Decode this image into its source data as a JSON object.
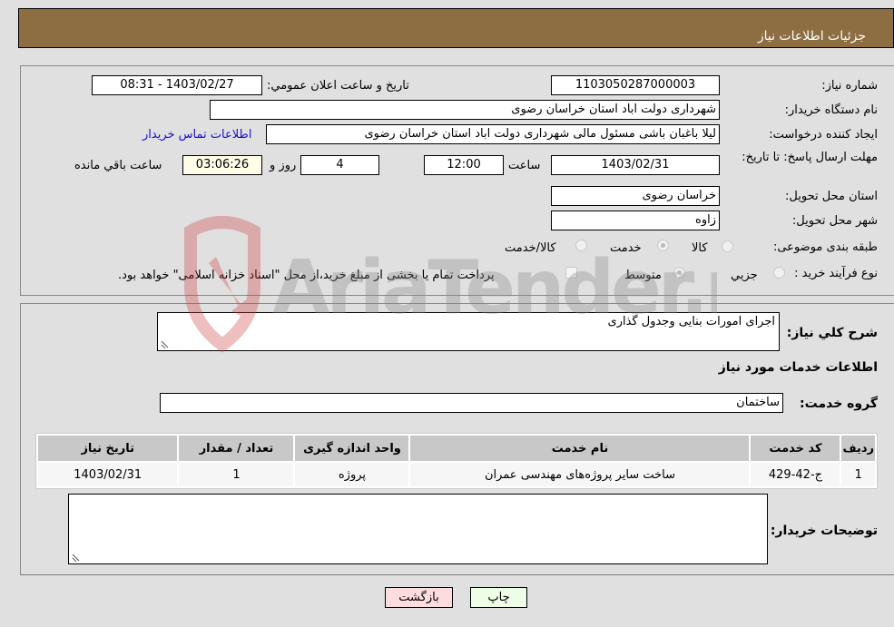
{
  "header": {
    "title": "جزئیات اطلاعات نیاز"
  },
  "fields": {
    "need_number_label": "شماره نیاز:",
    "need_number": "1103050287000003",
    "announce_label": "تاریخ و ساعت اعلان عمومي:",
    "announce_value": "1403/02/27 - 08:31",
    "buyer_org_label": "نام دستگاه خریدار:",
    "buyer_org": "شهرداری دولت اباد استان خراسان رضوی",
    "creator_label": "ایجاد کننده درخواست:",
    "creator": "لیلا باغبان باشی مسئول مالی شهرداری دولت اباد استان خراسان رضوی",
    "contact_link": "اطلاعات تماس خریدار",
    "deadline_label": "مهلت ارسال پاسخ: تا تاریخ:",
    "deadline_date": "1403/02/31",
    "time_label": "ساعت",
    "deadline_time": "12:00",
    "days": "4",
    "days_label": "روز و",
    "remaining": "03:06:26",
    "remaining_label": "ساعت باقي مانده",
    "province_label": "استان محل تحویل:",
    "province": "خراسان رضوی",
    "city_label": "شهر محل تحویل:",
    "city": "زاوه",
    "category_label": "طبقه بندی موضوعی:",
    "category_options": [
      {
        "label": "کالا",
        "checked": false
      },
      {
        "label": "خدمت",
        "checked": true
      },
      {
        "label": "کالا/خدمت",
        "checked": false
      }
    ],
    "process_label": "نوع فرآیند خرید :",
    "process_options": [
      {
        "label": "جزيي",
        "checked": false
      },
      {
        "label": "متوسط",
        "checked": true
      }
    ],
    "treasury_note": "پرداخت تمام یا بخشی از مبلغ خرید،از محل \"اسناد خزانه اسلامی\" خواهد بود.",
    "treasury_checked": false
  },
  "details": {
    "description_label": "شرح کلي نیاز:",
    "description": "اجرای امورات بنایی وجدول گذاری",
    "services_title": "اطلاعات خدمات مورد نیاز",
    "service_group_label": "گروه خدمت:",
    "service_group": "ساختمان",
    "table": {
      "headers": [
        "ردیف",
        "کد خدمت",
        "نام خدمت",
        "واحد اندازه گیری",
        "تعداد / مقدار",
        "تاریخ نیاز"
      ],
      "rows": [
        [
          "1",
          "ج-42-429",
          "ساخت سایر پروژه‌های مهندسی عمران",
          "پروژه",
          "1",
          "1403/02/31"
        ]
      ]
    },
    "buyer_notes_label": "توضیحات خریدار:",
    "buyer_notes": ""
  },
  "buttons": {
    "print": "چاپ",
    "back": "بازگشت"
  },
  "watermark": {
    "text": "AriaTender.neT"
  }
}
